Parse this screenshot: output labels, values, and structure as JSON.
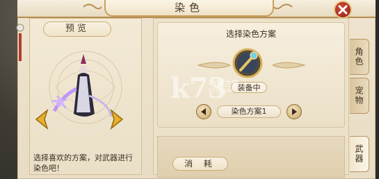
{
  "window": {
    "title": "染色"
  },
  "preview": {
    "label": "预览",
    "description": "选择喜欢的方案，对武器进行染色吧！"
  },
  "scheme": {
    "title": "选择染色方案",
    "status": "装备中",
    "current": "染色方案1"
  },
  "consume": {
    "label": "消 耗"
  },
  "tabs": [
    {
      "label": "角色"
    },
    {
      "label": "宠物"
    },
    {
      "label": "武器"
    }
  ],
  "watermark": {
    "brand": "k73",
    "name": "电玩之家",
    "url": "k73.com"
  },
  "colors": {
    "accent": "#caa063",
    "close": "#b8322a",
    "bg": "#ebdfc6"
  }
}
